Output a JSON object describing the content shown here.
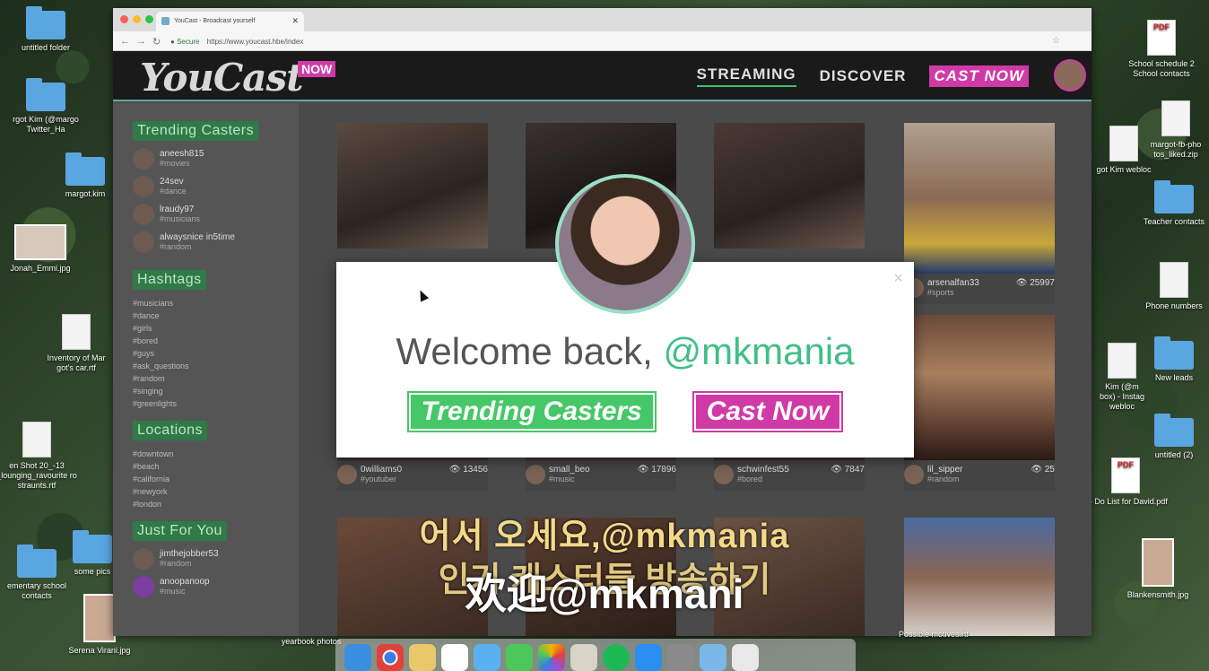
{
  "desktop": {
    "left_icons": [
      {
        "label": "untitled folder",
        "kind": "folder"
      },
      {
        "label": "rgot Kim (@margo\nTwitter_Ha",
        "kind": "folder"
      },
      {
        "label": "margot.kim",
        "kind": "folder"
      },
      {
        "label": "Jonah_Emmi.jpg",
        "kind": "thumb"
      },
      {
        "label": "Inventory of Mar\ngot's car.rtf",
        "kind": "file"
      },
      {
        "label": "en Shot 20_-13\n_lounging_ravourite ro\nstraunts.rtf",
        "kind": "file"
      },
      {
        "label": "some pics",
        "kind": "folder"
      },
      {
        "label": "ementary school\ncontacts",
        "kind": "folder"
      },
      {
        "label": "Serena Virani.jpg",
        "kind": "portrait"
      }
    ],
    "right_icons": [
      {
        "label": "School schedule 2\nSchool contacts",
        "kind": "pdf"
      },
      {
        "label": "margot-fb-pho\ntos_liked.zip",
        "kind": "file"
      },
      {
        "label": "got Kim webloc",
        "kind": "file"
      },
      {
        "label": "Teacher contacts",
        "kind": "folder"
      },
      {
        "label": "Phone numbers",
        "kind": "file"
      },
      {
        "label": "New leads",
        "kind": "folder"
      },
      {
        "label": "Kim (@m\nbox) - Instag\nwebloc",
        "kind": "file"
      },
      {
        "label": "untitled (2)",
        "kind": "folder"
      },
      {
        "label": "To Do List for David.pdf",
        "kind": "pdf"
      },
      {
        "label": "Blankensmith.jpg",
        "kind": "portrait"
      }
    ],
    "bottom_labels": [
      "yearbook photos",
      "Possible motives.rtf"
    ]
  },
  "browser": {
    "tab_title": "YouCast - Broadcast yourself",
    "url_secure": "Secure",
    "url": "https://www.youcast.hbe/index"
  },
  "site": {
    "logo": "YouCast",
    "logo_badge": "NOW",
    "nav": {
      "streaming": "STREAMING",
      "discover": "DISCOVER",
      "cast_now": "CAST NOW"
    },
    "sidebar": {
      "trending_title": "Trending Casters",
      "trending": [
        {
          "name": "aneesh815",
          "tag": "#movies"
        },
        {
          "name": "24sev",
          "tag": "#dance"
        },
        {
          "name": "lraudy97",
          "tag": "#musicians"
        },
        {
          "name": "alwaysnice in5time",
          "tag": "#random"
        }
      ],
      "hashtags_title": "Hashtags",
      "hashtags": [
        "#musicians",
        "#dance",
        "#girls",
        "#bored",
        "#guys",
        "#ask_questions",
        "#random",
        "#singing",
        "#greenlights"
      ],
      "locations_title": "Locations",
      "locations": [
        "#downtown",
        "#beach",
        "#california",
        "#newyork",
        "#london"
      ],
      "just_for_you_title": "Just For You",
      "just_for_you": [
        {
          "name": "jimthejobber53",
          "tag": "#random"
        },
        {
          "name": "anoopanoop",
          "tag": "#music"
        }
      ]
    },
    "tiles": [
      {
        "name": "",
        "tag": "",
        "views": ""
      },
      {
        "name": "",
        "tag": "",
        "views": ""
      },
      {
        "name": "",
        "tag": "",
        "views": ""
      },
      {
        "name": "arsenalfan33",
        "tag": "#sports",
        "views": "25997"
      },
      {
        "name": "0williams0",
        "tag": "#youtuber",
        "views": "13456"
      },
      {
        "name": "small_beo",
        "tag": "#music",
        "views": "17896"
      },
      {
        "name": "schwinfest55",
        "tag": "#bored",
        "views": "7847"
      },
      {
        "name": "lil_sipper",
        "tag": "#random",
        "views": "25"
      }
    ],
    "modal": {
      "welcome": "Welcome back,",
      "handle": "@mkmania",
      "close": "×",
      "btn_trending": "Trending Casters",
      "btn_cast": "Cast Now"
    }
  },
  "subtitles": {
    "korean_1": "어서 오세요,@mkmania",
    "korean_2": "인기 캐스터들 방송하기",
    "chinese": "欢迎@mkmani"
  },
  "colors": {
    "green": "#46c768",
    "pink": "#d03aa6",
    "handle_green": "#3fbf87"
  }
}
